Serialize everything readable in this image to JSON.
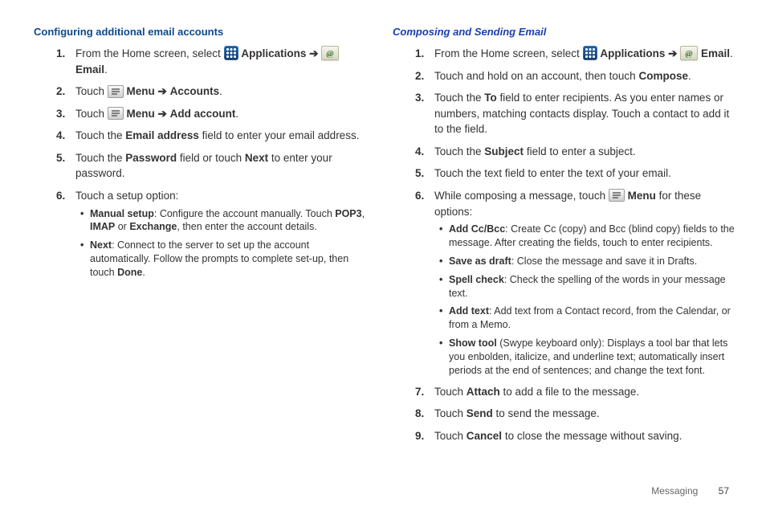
{
  "left": {
    "heading": "Configuring additional email accounts",
    "steps": [
      {
        "pre": "From the Home screen, select ",
        "apps": "Applications",
        "arrow": " ➔ ",
        "email": "Email",
        "post": "."
      },
      {
        "pre": "Touch ",
        "menu": "Menu",
        "arrow": " ➔ ",
        "target": "Accounts",
        "post": "."
      },
      {
        "pre": "Touch ",
        "menu": "Menu",
        "arrow": " ➔ ",
        "target": "Add account",
        "post": "."
      },
      {
        "pre": "Touch the ",
        "b1": "Email address",
        "post": " field to enter your email address."
      },
      {
        "pre": "Touch the ",
        "b1": "Password",
        "mid": " field or touch ",
        "b2": "Next",
        "post": " to enter your password."
      },
      {
        "pre": "Touch a setup option:"
      }
    ],
    "bullets": [
      {
        "b": "Manual setup",
        "t1": ": Configure the account manually. Touch ",
        "b2": "POP3",
        "t2": ", ",
        "b3": "IMAP",
        "t3": " or ",
        "b4": "Exchange",
        "t4": ", then enter the account details."
      },
      {
        "b": "Next",
        "t1": ": Connect to the server to set up the account automatically. Follow the prompts to complete set-up, then touch ",
        "b2": "Done",
        "t2": "."
      }
    ]
  },
  "right": {
    "heading": "Composing and Sending Email",
    "steps": [
      {
        "pre": "From the Home screen, select ",
        "apps": "Applications",
        "arrow": " ➔ ",
        "email": "Email",
        "post": "."
      },
      {
        "pre": "Touch and hold on an account, then touch ",
        "b1": "Compose",
        "post": "."
      },
      {
        "pre": "Touch the ",
        "b1": "To",
        "post": " field to enter recipients. As you enter names or numbers, matching contacts display. Touch a contact to add it to the field."
      },
      {
        "pre": "Touch the ",
        "b1": "Subject",
        "post": " field to enter a subject."
      },
      {
        "pre": "Touch the text field to enter the text of your email."
      },
      {
        "pre": "While composing a message, touch ",
        "menu": "Menu",
        "post": " for these options:"
      }
    ],
    "bullets": [
      {
        "b": "Add Cc/Bcc",
        "t": ": Create Cc (copy) and Bcc (blind copy) fields to the message. After creating the fields, touch to enter recipients."
      },
      {
        "b": "Save as draft",
        "t": ": Close the message and save it in Drafts."
      },
      {
        "b": "Spell check",
        "t": ": Check the spelling of the words in your message text."
      },
      {
        "b": "Add text",
        "t": ": Add text from a Contact record, from the Calendar, or from a Memo."
      },
      {
        "b": "Show tool",
        "t": " (Swype keyboard only): Displays a tool bar that lets you enbolden, italicize, and underline text; automatically insert periods at the end of sentences; and change the text font."
      }
    ],
    "steps2": [
      {
        "n": "7.",
        "pre": "Touch ",
        "b1": "Attach",
        "post": " to add a file to the message."
      },
      {
        "n": "8.",
        "pre": "Touch ",
        "b1": "Send",
        "post": " to send the message."
      },
      {
        "n": "9.",
        "pre": "Touch ",
        "b1": "Cancel",
        "post": " to close the message without saving."
      }
    ]
  },
  "footer": {
    "section": "Messaging",
    "page": "57"
  }
}
